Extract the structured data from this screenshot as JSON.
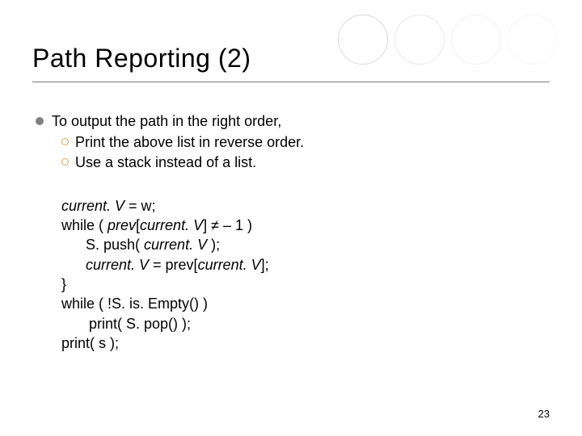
{
  "title": "Path Reporting (2)",
  "bullet_main": "To output the path in the right order,",
  "sub_items": [
    "Print the above list in reverse order.",
    "Use a stack instead of a list."
  ],
  "code": {
    "l1_a": "current. V",
    "l1_b": " = w;",
    "l2_a": "while ( ",
    "l2_b": "prev",
    "l2_c": "[",
    "l2_d": "current. V",
    "l2_e": "] ≠ – 1 )",
    "l3_a": "S. push( ",
    "l3_b": "current. V",
    "l3_c": " );",
    "l4_a": "current. V",
    "l4_b": " = prev[",
    "l4_c": "current. V",
    "l4_d": "];",
    "l5": "}",
    "l6": "while ( !S. is. Empty() )",
    "l7": "print( S. pop() );",
    "l8": "print( s );"
  },
  "page_number": "23"
}
